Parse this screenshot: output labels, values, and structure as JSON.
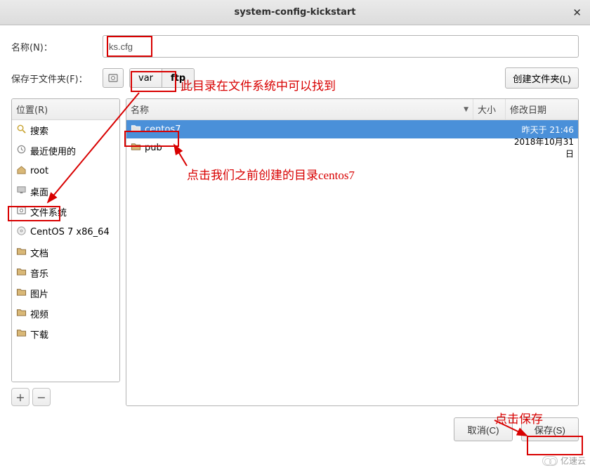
{
  "window": {
    "title": "system-config-kickstart"
  },
  "name_row": {
    "label": "名称(N)：",
    "value": "ks.cfg"
  },
  "folder_row": {
    "label": "保存于文件夹(F)：",
    "crumb1": "var",
    "crumb2": "ftp",
    "mkdir": "创建文件夹(L)"
  },
  "places_header": "位置(R)",
  "places": [
    {
      "label": "搜索",
      "icon": "search"
    },
    {
      "label": "最近使用的",
      "icon": "recent"
    },
    {
      "label": "root",
      "icon": "home"
    },
    {
      "label": "桌面",
      "icon": "desktop"
    },
    {
      "label": "文件系统",
      "icon": "fs"
    },
    {
      "label": "CentOS 7 x86_64",
      "icon": "cd"
    },
    {
      "label": "文档",
      "icon": "folder"
    },
    {
      "label": "音乐",
      "icon": "folder"
    },
    {
      "label": "图片",
      "icon": "folder"
    },
    {
      "label": "视频",
      "icon": "folder"
    },
    {
      "label": "下载",
      "icon": "folder"
    }
  ],
  "columns": {
    "name": "名称",
    "size": "大小",
    "date": "修改日期"
  },
  "files": [
    {
      "name": "centos7",
      "date": "昨天于 21:46",
      "selected": true
    },
    {
      "name": "pub",
      "date": "2018年10月31日",
      "selected": false
    }
  ],
  "footer": {
    "cancel": "取消(C)",
    "save": "保存(S)"
  },
  "annotations": {
    "a1": "此目录在文件系统中可以找到",
    "a2": "点击我们之前创建的目录centos7",
    "a3": "点击保存"
  },
  "watermark": "亿速云"
}
